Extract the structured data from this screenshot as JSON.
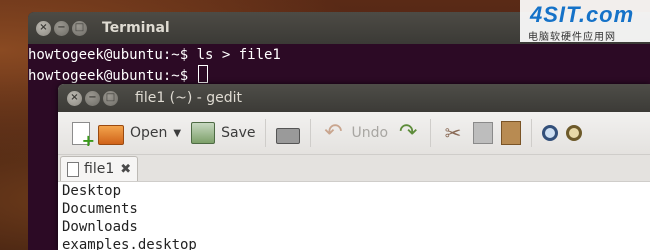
{
  "terminal": {
    "title": "Terminal",
    "lines": [
      "howtogeek@ubuntu:~$ ls > file1",
      "howtogeek@ubuntu:~$ "
    ]
  },
  "gedit": {
    "title": "file1 (~) - gedit",
    "toolbar": {
      "open_label": "Open",
      "save_label": "Save",
      "undo_label": "Undo"
    },
    "tab": {
      "label": "file1",
      "close_glyph": "✖"
    },
    "document_lines": [
      "Desktop",
      "Documents",
      "Downloads",
      "examples.desktop"
    ]
  },
  "watermark": {
    "main": "4SIT.com",
    "sub": "电脑软硬件应用网"
  },
  "window_buttons": {
    "close": "×",
    "minimize": "−",
    "maximize": "□"
  }
}
